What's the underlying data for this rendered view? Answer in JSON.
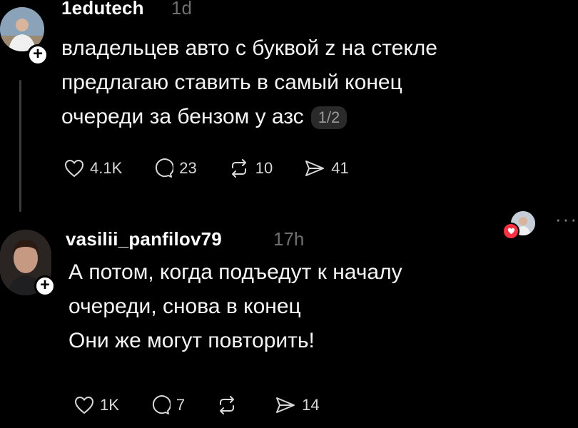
{
  "posts": [
    {
      "username": "1edutech",
      "time": "1d",
      "lines": [
        "владельцев авто с буквой z на стекле",
        "предлагаю ставить в самый конец",
        "очереди за бензом у азс"
      ],
      "page_indicator": "1/2",
      "likes": "4.1K",
      "replies": "23",
      "reposts": "10",
      "shares": "41"
    },
    {
      "username": "vasilii_panfilov79",
      "time": "17h",
      "lines": [
        "А потом, когда подъедут к началу",
        "очереди, снова в конец",
        "Они же могут повторить!"
      ],
      "likes": "1K",
      "replies": "7",
      "reposts": "",
      "shares": "14",
      "more_label": "···"
    }
  ],
  "icons": {
    "like": "heart-icon",
    "reply": "comment-icon",
    "repost": "repost-icon",
    "share": "send-icon",
    "follow": "plus-icon"
  },
  "colors": {
    "background": "#000000",
    "text": "#f2f2f2",
    "muted": "#6f6f6f",
    "like_badge": "#ff3040"
  }
}
